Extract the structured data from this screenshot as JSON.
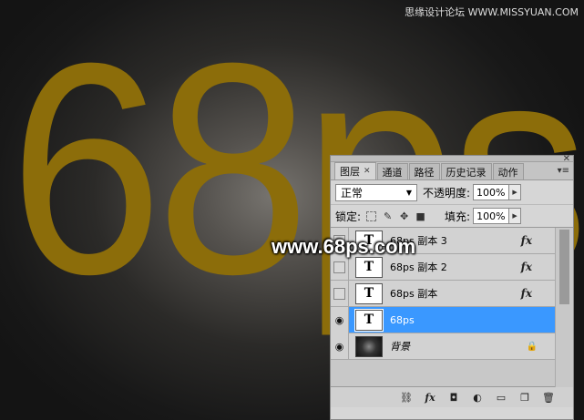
{
  "canvas": {
    "big_text": "68ps",
    "text_color": "#8c6d0a"
  },
  "watermarks": {
    "top": "思缘设计论坛 WWW.MISSYUAN.COM",
    "middle": "www.68ps.com"
  },
  "panel": {
    "tabs": [
      {
        "label": "图层",
        "active": true
      },
      {
        "label": "通道",
        "active": false
      },
      {
        "label": "路径",
        "active": false
      },
      {
        "label": "历史记录",
        "active": false
      },
      {
        "label": "动作",
        "active": false
      }
    ],
    "close_glyph": "✕",
    "tab_close_glyph": "✕",
    "menu_glyph": "▾≡",
    "blend_mode": "正常",
    "opacity_label": "不透明度:",
    "opacity_value": "100%",
    "lock_label": "锁定:",
    "fill_label": "填充:",
    "fill_value": "100%",
    "layers": [
      {
        "name": "68ps 副本 3",
        "type": "text",
        "visible": false,
        "fx": "fx",
        "selected": false
      },
      {
        "name": "68ps 副本 2",
        "type": "text",
        "visible": false,
        "fx": "fx",
        "selected": false
      },
      {
        "name": "68ps 副本",
        "type": "text",
        "visible": false,
        "fx": "fx",
        "selected": false
      },
      {
        "name": "68ps",
        "type": "text",
        "visible": true,
        "fx": "",
        "selected": true
      },
      {
        "name": "背景",
        "type": "background",
        "visible": true,
        "fx": "",
        "selected": false
      }
    ],
    "thumb_glyph": "T",
    "eye_glyph": "👁",
    "bottom_icons": [
      "link-icon",
      "fx-icon",
      "mask-icon",
      "adjustment-icon",
      "folder-icon",
      "new-layer-icon",
      "trash-icon"
    ]
  }
}
